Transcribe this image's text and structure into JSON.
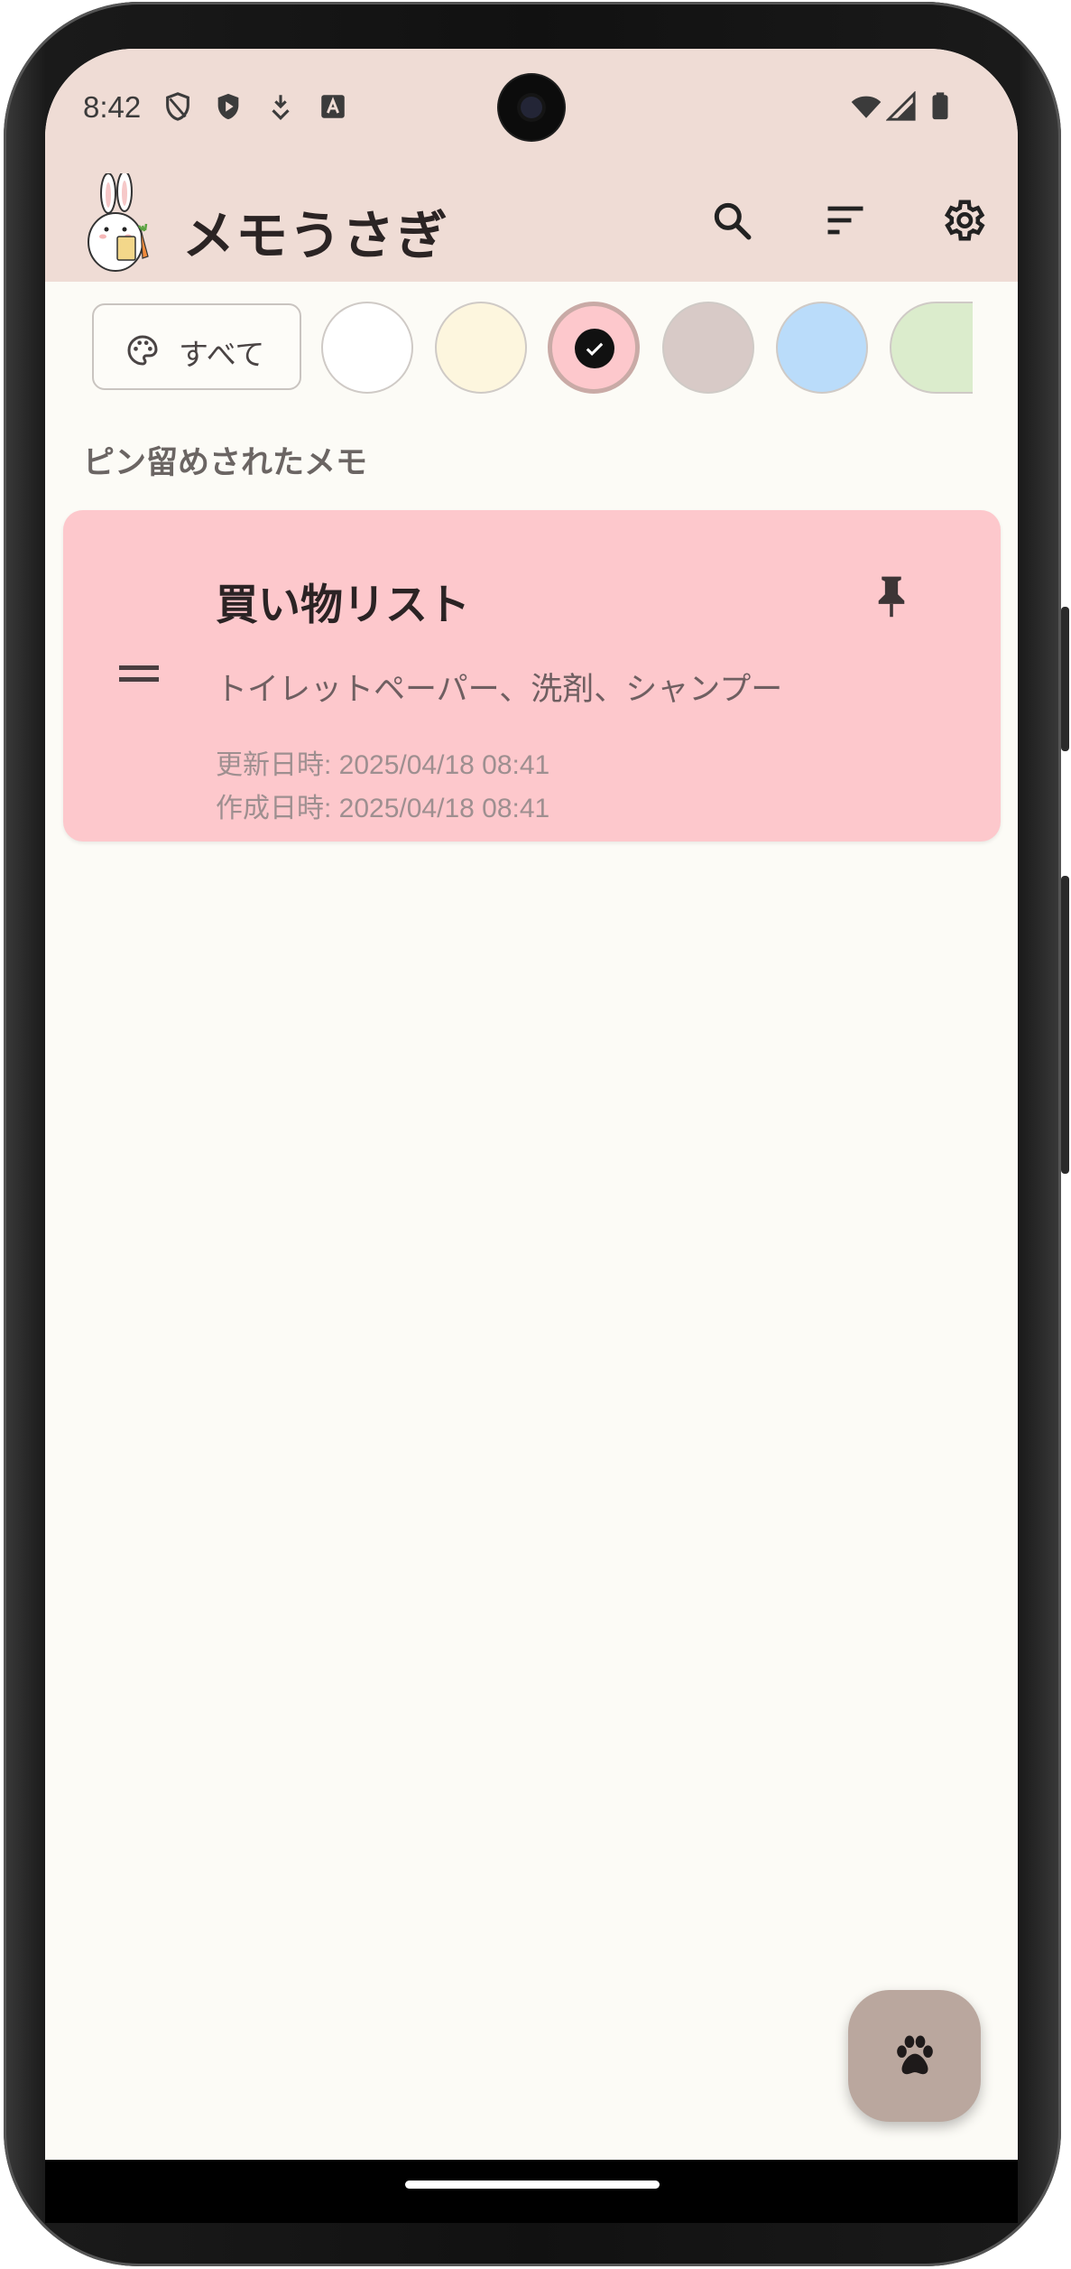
{
  "status_bar": {
    "time": "8:42",
    "left_icons": [
      "shield-outline-icon",
      "shield-play-icon",
      "download-check-icon",
      "font-a-icon"
    ],
    "right_icons": [
      "wifi-icon",
      "cellular-signal-icon",
      "battery-icon"
    ]
  },
  "app_bar": {
    "title": "メモうさぎ",
    "logo_icon": "rabbit-holding-carrot-icon",
    "actions": [
      "search-icon",
      "sort-icon",
      "settings-gear-icon"
    ]
  },
  "color_filter": {
    "all_label": "すべて",
    "all_icon": "palette-icon",
    "swatches": [
      {
        "name": "white",
        "color": "#ffffff",
        "selected": false
      },
      {
        "name": "cream",
        "color": "#fdf6de",
        "selected": false
      },
      {
        "name": "pink",
        "color": "#fdc8cc",
        "selected": true
      },
      {
        "name": "taupe",
        "color": "#d8cac7",
        "selected": false
      },
      {
        "name": "blue",
        "color": "#badcfa",
        "selected": false
      },
      {
        "name": "green",
        "color": "#dbeccc",
        "selected": false
      }
    ]
  },
  "pinned_section": {
    "heading": "ピン留めされたメモ",
    "memos": [
      {
        "title": "買い物リスト",
        "body": "トイレットペーパー、洗剤、シャンプー",
        "updated": "更新日時: 2025/04/18 08:41",
        "created": "作成日時: 2025/04/18 08:41",
        "pinned": true,
        "color": "#fdc8cc"
      }
    ]
  },
  "fab": {
    "icon": "paw-icon",
    "color": "#baa79e"
  }
}
